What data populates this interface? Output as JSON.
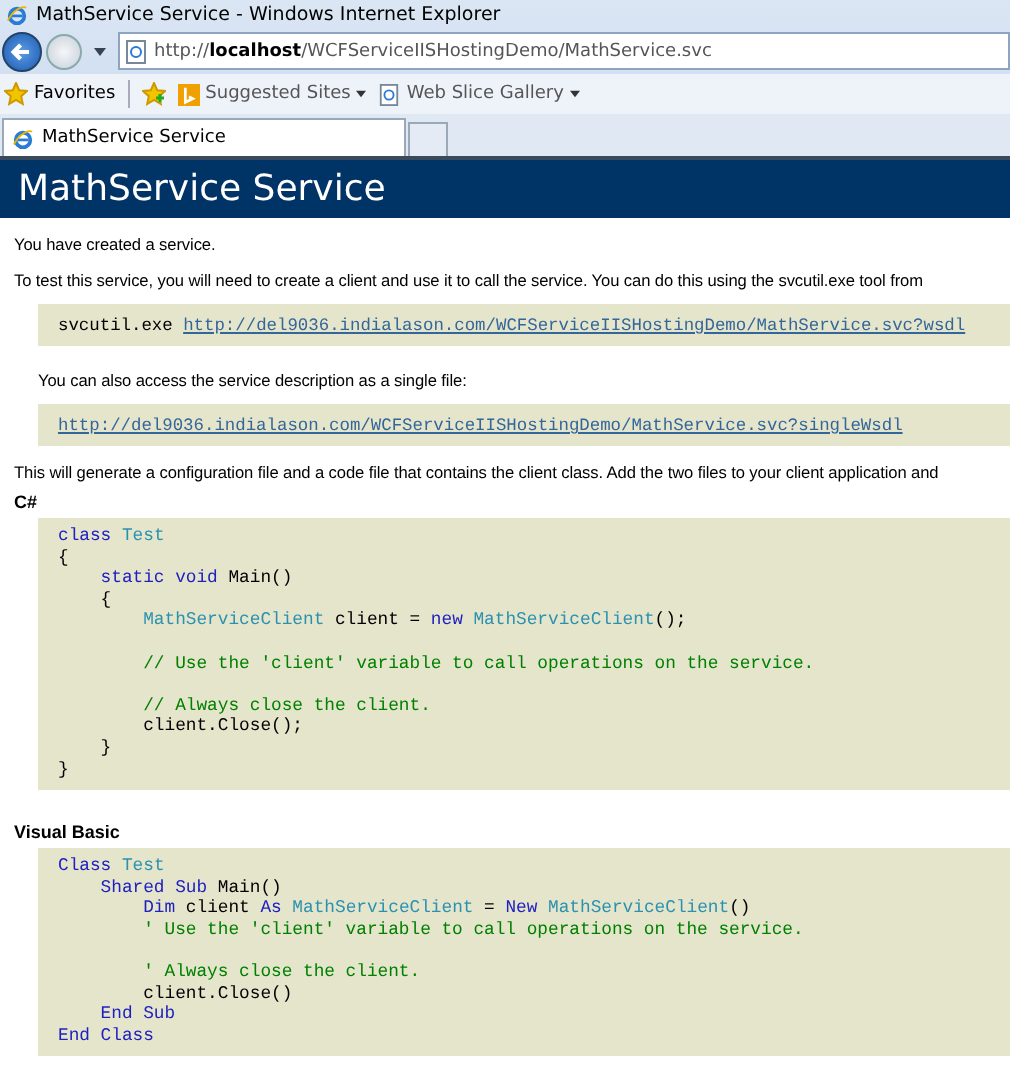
{
  "window": {
    "title": "MathService Service - Windows Internet Explorer"
  },
  "address_bar": {
    "url": "http://**localhost**/WCFServiceIISHostingDemo/MathService.svc"
  },
  "favorites_bar": {
    "favorites": "Favorites",
    "items": [
      {
        "label": "Suggested Sites",
        "kind": "bing"
      },
      {
        "label": "Web Slice Gallery",
        "kind": "page"
      }
    ]
  },
  "tabs": [
    {
      "label": "MathService Service",
      "selected": true
    }
  ],
  "page": {
    "heading": "MathService Service",
    "sections": [
      {
        "kind": "paragraph",
        "text": "You have created a service."
      },
      {
        "kind": "paragraph",
        "text": "To test this service, you will need to create a client and use it to call the service. You can do this using the svcutil.exe tool from"
      },
      {
        "kind": "command",
        "text": "svcutil.exe",
        "link": "http://del9036.indialason.com/WCFServiceIISHostingDemo/MathService.svc?wsdl"
      },
      {
        "kind": "indented_paragraph",
        "text": "You can also access the service description as a single file:"
      },
      {
        "kind": "link_box",
        "link": "http://del9036.indialason.com/WCFServiceIISHostingDemo/MathService.svc?singleWsdl"
      },
      {
        "kind": "paragraph",
        "text": "This will generate a configuration file and a code file that contains the client class. Add the two files to your client application and"
      },
      {
        "kind": "code_heading",
        "text": "C#"
      },
      {
        "kind": "code",
        "lines": [
          {
            "kind": "code",
            "tokens": [
              {
                "kind": "keyword",
                "text": "class"
              },
              {
                "kind": "type",
                "text": " Test"
              }
            ]
          },
          {
            "kind": "code",
            "tokens": [
              {
                "kind": "plain",
                "text": "{"
              }
            ]
          },
          {
            "kind": "code",
            "tokens": [
              {
                "kind": "keyword",
                "text": "    static void"
              },
              {
                "kind": "plain",
                "text": " Main()"
              }
            ]
          },
          {
            "kind": "code",
            "tokens": [
              {
                "kind": "plain",
                "text": "    {"
              }
            ]
          },
          {
            "kind": "code",
            "tokens": [
              {
                "kind": "type",
                "text": "        MathServiceClient"
              },
              {
                "kind": "plain",
                "text": " client = "
              },
              {
                "kind": "keyword",
                "text": "new"
              },
              {
                "kind": "type",
                "text": " MathServiceClient"
              },
              {
                "kind": "plain",
                "text": "();"
              }
            ]
          },
          {
            "kind": "blank"
          },
          {
            "kind": "code",
            "tokens": [
              {
                "kind": "comment",
                "text": "        // Use the 'client' variable to call operations on the service."
              }
            ]
          },
          {
            "kind": "blank"
          },
          {
            "kind": "code",
            "tokens": [
              {
                "kind": "comment",
                "text": "        // Always close the client."
              }
            ]
          },
          {
            "kind": "code",
            "tokens": [
              {
                "kind": "plain",
                "text": "        client.Close();"
              }
            ]
          },
          {
            "kind": "code",
            "tokens": [
              {
                "kind": "plain",
                "text": "    }"
              }
            ]
          },
          {
            "kind": "code",
            "tokens": [
              {
                "kind": "plain",
                "text": "}"
              }
            ]
          }
        ]
      },
      {
        "kind": "code_heading",
        "text": "Visual Basic"
      },
      {
        "kind": "code",
        "lines": [
          {
            "kind": "code",
            "tokens": [
              {
                "kind": "keyword",
                "text": "Class"
              },
              {
                "kind": "type",
                "text": " Test"
              }
            ]
          },
          {
            "kind": "code",
            "tokens": [
              {
                "kind": "keyword",
                "text": "    Shared Sub"
              },
              {
                "kind": "plain",
                "text": " Main()"
              }
            ]
          },
          {
            "kind": "code",
            "tokens": [
              {
                "kind": "keyword",
                "text": "        Dim"
              },
              {
                "kind": "plain",
                "text": " client "
              },
              {
                "kind": "keyword",
                "text": "As"
              },
              {
                "kind": "type",
                "text": " MathServiceClient"
              },
              {
                "kind": "plain",
                "text": " = "
              },
              {
                "kind": "keyword",
                "text": "New"
              },
              {
                "kind": "type",
                "text": " MathServiceClient"
              },
              {
                "kind": "plain",
                "text": "()"
              }
            ]
          },
          {
            "kind": "code",
            "tokens": [
              {
                "kind": "comment",
                "text": "        ' Use the 'client' variable to call operations on the service."
              }
            ]
          },
          {
            "kind": "blank"
          },
          {
            "kind": "code",
            "tokens": [
              {
                "kind": "comment",
                "text": "        ' Always close the client."
              }
            ]
          },
          {
            "kind": "code",
            "tokens": [
              {
                "kind": "plain",
                "text": "        client.Close()"
              }
            ]
          },
          {
            "kind": "code",
            "tokens": [
              {
                "kind": "keyword",
                "text": "    End Sub"
              }
            ]
          },
          {
            "kind": "code",
            "tokens": [
              {
                "kind": "keyword",
                "text": "End Class"
              }
            ]
          }
        ]
      }
    ]
  }
}
